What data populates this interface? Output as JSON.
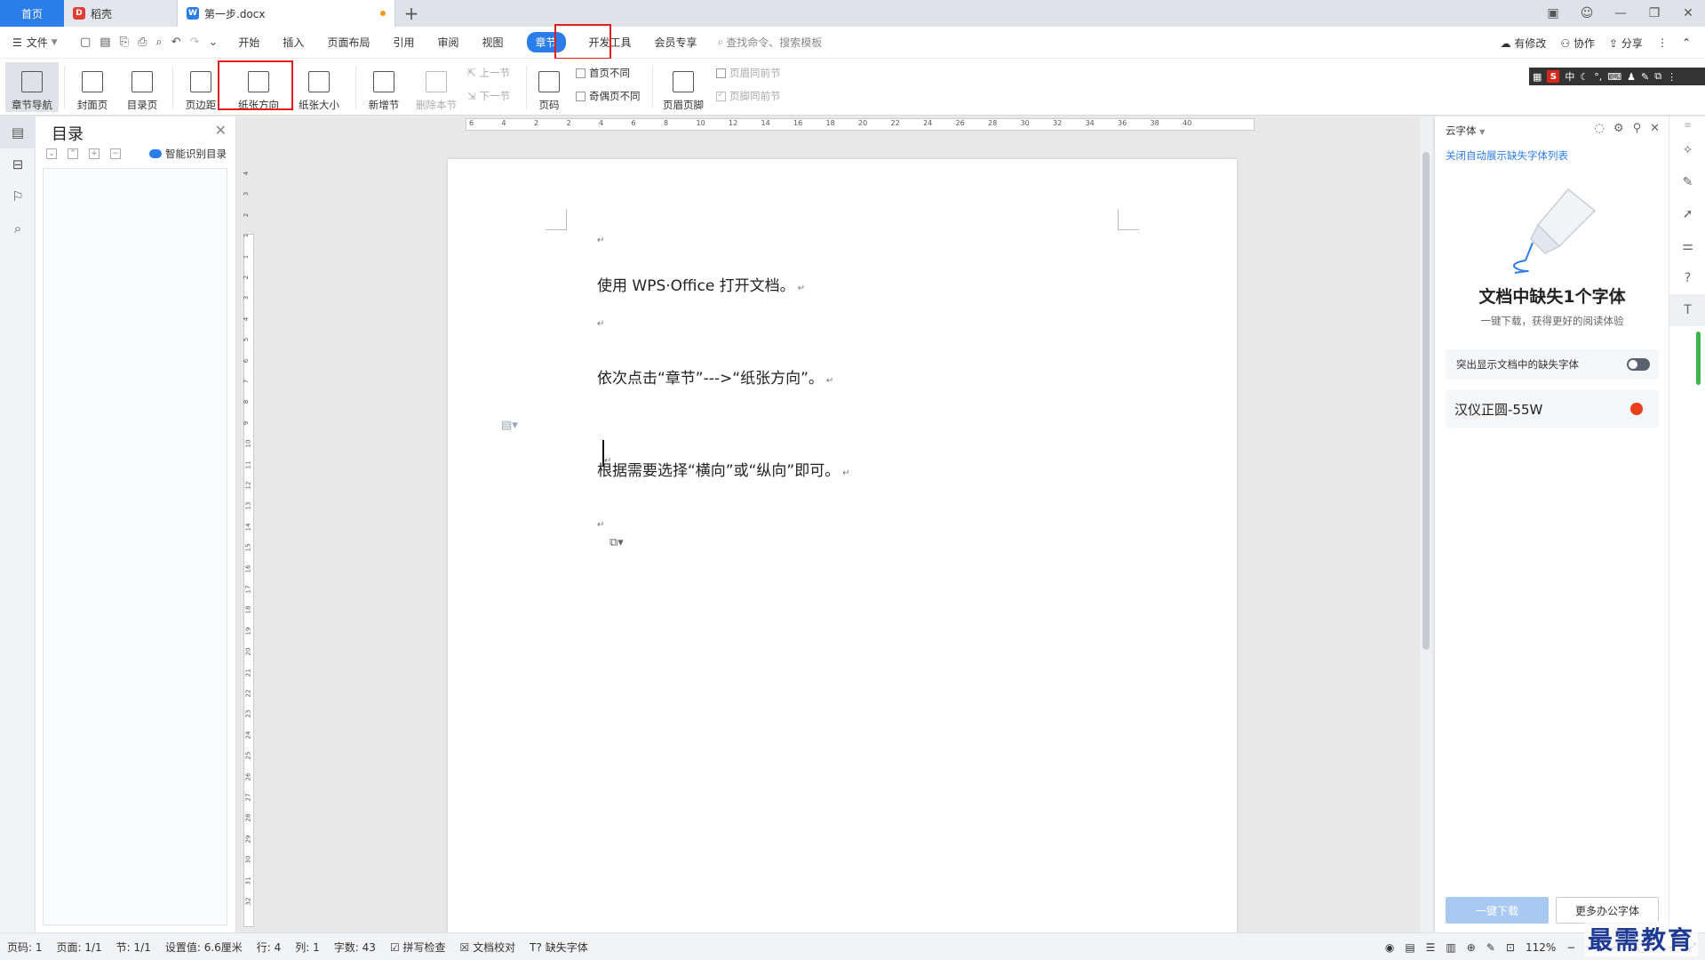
{
  "titlebar": {
    "home_tab": "首页",
    "tabs": [
      {
        "label": "稻壳"
      },
      {
        "label": "第一步.docx"
      }
    ],
    "new_tab": "+"
  },
  "menubar": {
    "file_label": "文件",
    "items": [
      "开始",
      "插入",
      "页面布局",
      "引用",
      "审阅",
      "视图",
      "章节",
      "开发工具",
      "会员专享"
    ],
    "active_item": "章节",
    "search_placeholder": "查找命令、搜索模板",
    "right": {
      "revise": "有修改",
      "collaborate": "协作",
      "share": "分享"
    }
  },
  "ribbon": {
    "chapter_nav": "章节导航",
    "cover": "封面页",
    "toc_page": "目录页",
    "margin": "页边距",
    "orientation": "纸张方向",
    "paper_size": "纸张大小",
    "new_section": "新增节",
    "delete_section": "删除本节",
    "prev_section": "上一节",
    "next_section": "下一节",
    "page_number": "页码",
    "first_page_diff": "首页不同",
    "odd_even_diff": "奇偶页不同",
    "header_footer": "页眉页脚",
    "header_same_prev": "页眉同前节",
    "footer_same_prev": "页脚同前节"
  },
  "ime_bar": {
    "mode": "中"
  },
  "toc_panel": {
    "title": "目录",
    "smart_label": "智能识别目录"
  },
  "ruler": {
    "h_ticks": [
      "6",
      "4",
      "2",
      "2",
      "4",
      "6",
      "8",
      "10",
      "12",
      "14",
      "16",
      "18",
      "20",
      "22",
      "24",
      "26",
      "28",
      "30",
      "32",
      "34",
      "36",
      "38",
      "40"
    ],
    "v_ticks": [
      "4",
      "3",
      "2",
      "1",
      "1",
      "2",
      "3",
      "4",
      "5",
      "6",
      "7",
      "8",
      "9",
      "10",
      "11",
      "12",
      "13",
      "14",
      "15",
      "16",
      "17",
      "18",
      "19",
      "20",
      "21",
      "22",
      "23",
      "24",
      "25",
      "26",
      "27",
      "28",
      "29",
      "30",
      "31",
      "32"
    ]
  },
  "document": {
    "paragraphs": [
      "使用 WPS·Office 打开文档。",
      "依次点击“章节”--->“纸张方向”。",
      "根据需要选择“横向”或“纵向”即可。"
    ],
    "para_mark": "↵"
  },
  "font_panel": {
    "header": "云字体",
    "close_auto_link": "关闭自动展示缺失字体列表",
    "title": "文档中缺失1个字体",
    "subtitle": "一键下载，获得更好的阅读体验",
    "toggle_label": "突出显示文档中的缺失字体",
    "missing_font": "汉仪正圆-55W",
    "download_button": "一键下载",
    "more_button": "更多办公字体"
  },
  "statusbar": {
    "page_no": "页码: 1",
    "page": "页面: 1/1",
    "section": "节: 1/1",
    "setting": "设置值: 6.6厘米",
    "row": "行: 4",
    "col": "列: 1",
    "words": "字数: 43",
    "spell": "拼写检查",
    "proof": "文档校对",
    "missing_font": "缺失字体",
    "zoom": "112%"
  },
  "watermark": "最需教育"
}
